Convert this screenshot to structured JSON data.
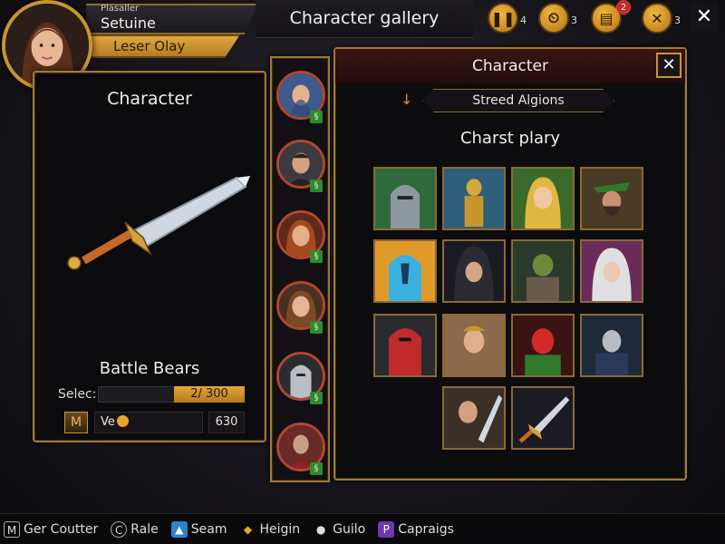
{
  "player": {
    "tiny_label": "Plasaller",
    "name": "Setuine",
    "subtitle": "Leser Olay"
  },
  "header": {
    "title": "Character gallery"
  },
  "top_buttons": [
    {
      "icon": "pause-icon",
      "count": "4"
    },
    {
      "icon": "timer-icon",
      "count": "3"
    },
    {
      "icon": "chest-icon",
      "count": "",
      "badge": "2"
    },
    {
      "icon": "cross-icon",
      "count": "3"
    }
  ],
  "close_glyph": "✕",
  "left_panel": {
    "title": "Character",
    "item_name": "Battle Bears",
    "select_label": "Selec:",
    "select_value": "2/ 300",
    "ve_label": "Ve",
    "ve_value": "630"
  },
  "column_badges": [
    "§",
    "§",
    "§",
    "§",
    "§",
    "§"
  ],
  "right_panel": {
    "title": "Character",
    "filter": "Streed Algions",
    "section_title": "Charst plary"
  },
  "bottom_nav": [
    {
      "icon": "m-icon",
      "label": "Ger Coutter"
    },
    {
      "icon": "copyright-icon",
      "label": "Rale"
    },
    {
      "icon": "triangle-icon",
      "label": "Seam"
    },
    {
      "icon": "diamond-icon",
      "label": "Heigin"
    },
    {
      "icon": "person-icon",
      "label": "Guilo"
    },
    {
      "icon": "p-icon",
      "label": "Capraigs"
    }
  ],
  "colors": {
    "gold": "#c8952e",
    "accent_red": "#3a1414",
    "badge_green": "#2f8a2c"
  }
}
